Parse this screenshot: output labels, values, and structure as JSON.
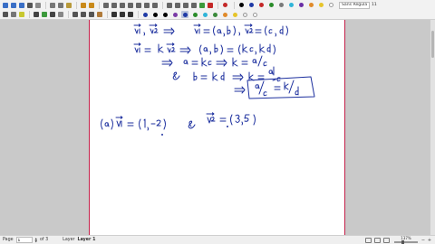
{
  "toolbar_top": {
    "buttons": [
      {
        "name": "new-document-icon",
        "color": "#3a6fc6"
      },
      {
        "name": "open-document-icon",
        "color": "#3a6fc6"
      },
      {
        "name": "save-icon",
        "color": "#3a6fc6"
      },
      {
        "name": "print-icon",
        "color": "#555555"
      },
      {
        "name": "export-pdf-icon",
        "color": "#8a8a8a"
      },
      {
        "name": "cut-icon",
        "color": "#777777"
      },
      {
        "name": "copy-icon",
        "color": "#777777"
      },
      {
        "name": "paste-icon",
        "color": "#b89a3a"
      },
      {
        "name": "undo-icon",
        "color": "#c98a1a"
      },
      {
        "name": "redo-icon",
        "color": "#c98a1a"
      },
      {
        "name": "insert-page-before-icon",
        "color": "#666666"
      },
      {
        "name": "insert-page-after-icon",
        "color": "#666666"
      },
      {
        "name": "delete-page-icon",
        "color": "#666666"
      },
      {
        "name": "zoom-fit-icon",
        "color": "#666666"
      },
      {
        "name": "zoom-in-icon",
        "color": "#666666"
      },
      {
        "name": "zoom-out-icon",
        "color": "#666666"
      },
      {
        "name": "fullscreen-icon",
        "color": "#666666"
      },
      {
        "name": "first-page-icon",
        "color": "#666666"
      },
      {
        "name": "previous-page-icon",
        "color": "#666666"
      },
      {
        "name": "next-page-icon",
        "color": "#666666"
      },
      {
        "name": "last-page-icon",
        "color": "#666666"
      },
      {
        "name": "goto-page-icon",
        "color": "#3c9a3c"
      },
      {
        "name": "close-icon",
        "color": "#c42828"
      }
    ],
    "recording_color": "#c42828",
    "pen_colors": [
      "#000000",
      "#1f3aa6",
      "#c42828",
      "#2a8c2a",
      "#7a7a7a",
      "#2fb4d8",
      "#6a2fa6",
      "#e08a2a",
      "#e6c42a",
      "#ffffff"
    ],
    "font": {
      "name": "Sans Regular",
      "size": "11"
    }
  },
  "toolbar_second": {
    "buttons": [
      {
        "name": "pen-tool-icon",
        "color": "#555555"
      },
      {
        "name": "eraser-icon",
        "color": "#777777"
      },
      {
        "name": "highlighter-icon",
        "color": "#c8c830"
      },
      {
        "name": "text-tool-icon",
        "color": "#444444"
      },
      {
        "name": "image-tool-icon",
        "color": "#3c9a3c"
      },
      {
        "name": "draw-shape-icon",
        "color": "#444444"
      },
      {
        "name": "ruler-icon",
        "color": "#888888"
      },
      {
        "name": "select-rect-icon",
        "color": "#555555"
      },
      {
        "name": "select-region-icon",
        "color": "#555555"
      },
      {
        "name": "vertical-space-icon",
        "color": "#555555"
      },
      {
        "name": "hand-tool-icon",
        "color": "#b07a3a"
      },
      {
        "name": "fine-line-icon",
        "color": "#333333"
      },
      {
        "name": "medium-line-icon",
        "color": "#333333"
      },
      {
        "name": "thick-line-icon",
        "color": "#333333"
      }
    ],
    "pen_colors": [
      "#1f3aa6",
      "#000000",
      "#000000",
      "#7a3aa6",
      "#1f3aa6",
      "#2a8c2a",
      "#2fb4d8",
      "#3a8a3a",
      "#e08a2a",
      "#e6c42a",
      "#f0f0f0",
      "#ffffff"
    ],
    "selected_color_index": 4
  },
  "statusbar": {
    "page_label": "Page",
    "page_value": "1",
    "of_pages": "of 3",
    "layer_label": "Layer",
    "layer_value": "Layer 1",
    "zoom_text": "137%"
  }
}
